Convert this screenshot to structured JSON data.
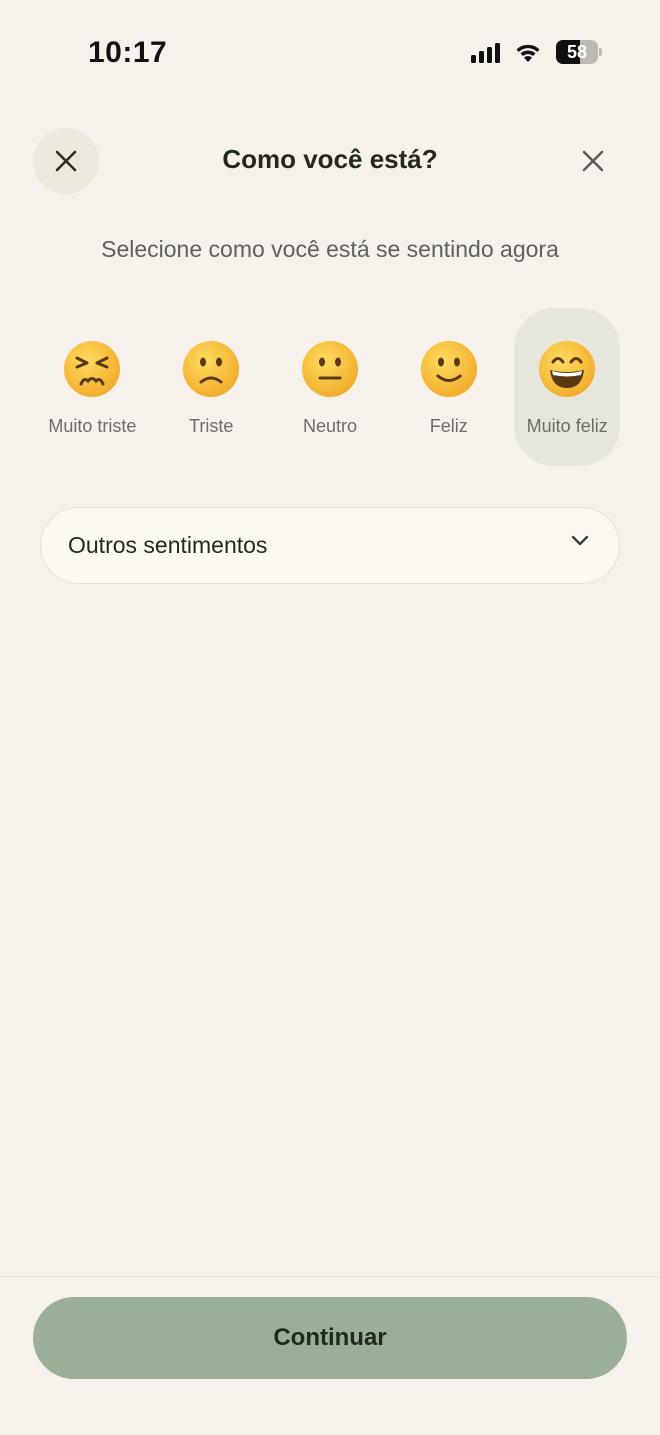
{
  "status_bar": {
    "time": "10:17",
    "battery_level": "58",
    "signal_bars": 4,
    "signal_bars_active": 4
  },
  "header": {
    "title": "Como você está?",
    "left_icon": "close-icon",
    "right_icon": "close-icon"
  },
  "subtitle": "Selecione como você está se sentindo agora",
  "moods": [
    {
      "label": "Muito triste",
      "icon": "persevering-face-icon",
      "selected": false
    },
    {
      "label": "Triste",
      "icon": "slightly-frowning-face-icon",
      "selected": false
    },
    {
      "label": "Neutro",
      "icon": "neutral-face-icon",
      "selected": false
    },
    {
      "label": "Feliz",
      "icon": "slightly-smiling-face-icon",
      "selected": false
    },
    {
      "label": "Muito feliz",
      "icon": "grinning-face-icon",
      "selected": true
    }
  ],
  "dropdown": {
    "label": "Outros sentimentos",
    "icon": "chevron-down-icon"
  },
  "footer": {
    "continue_label": "Continuar"
  },
  "colors": {
    "background": "#f6f1ea",
    "primary_button": "#9baf98",
    "selected_mood_bg": "#e7e6dc",
    "emoji_yellow": "#f6c33a"
  }
}
